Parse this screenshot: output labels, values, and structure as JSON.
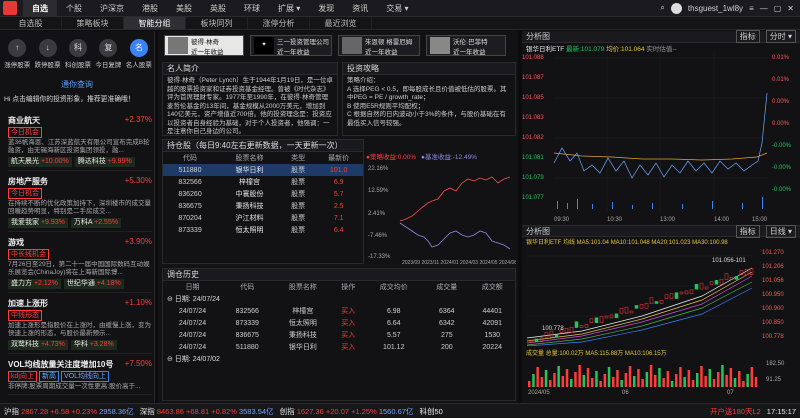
{
  "topbar": {
    "tabs": [
      "自选",
      "个股",
      "沪深京",
      "港股",
      "美股",
      "英股",
      "环球",
      "扩展",
      "发现",
      "资讯",
      "交易"
    ],
    "user": "thsguest_1wl8y"
  },
  "subnav": {
    "tabs": [
      "自选股",
      "策略板块",
      "智能分组",
      "板块同列",
      "涨停分析",
      "最近浏览"
    ]
  },
  "left": {
    "buttons": [
      "涨停股票",
      "跌停股票",
      "科创股票",
      "今日复牌",
      "名人股票"
    ],
    "link": "通你查询",
    "prompt": "Hi 点击编辑你的投资形象，推荐更准确哦！",
    "cards": [
      {
        "title": "商业航天",
        "pct": "+2.37%",
        "tag": "今日机会",
        "desc": "蓝36帆海恩、江苏深蓝航天有限公司宣布完成B轮融资，由无锡海新区投资集团领投，融...",
        "chips": [
          [
            "航天晨光",
            "+10.00%"
          ],
          [
            "腾达科技",
            "+9.99%"
          ]
        ]
      },
      {
        "title": "房地产服务",
        "pct": "+5.30%",
        "tag": "今日机会",
        "desc": "在持续不断的优化政策加持下，深圳楼市的成交量回暖趋势明显，特别是二手房成交...",
        "chips": [
          [
            "我爱我家",
            "+9.93%"
          ],
          [
            "万科A",
            "+2.55%"
          ]
        ]
      },
      {
        "title": "游戏",
        "pct": "+3.90%",
        "tag": "中长线机会",
        "desc": "7月26日至29日，第二十一届中国国际数码互动娱乐展览会(ChinaJoy)将在上海新国际博...",
        "chips": [
          [
            "盛力方",
            "+2.12%"
          ],
          [
            "世纪华通",
            "+4.18%"
          ]
        ]
      },
      {
        "title": "加速上涨形",
        "pct": "+1.10%",
        "tag": "中线形态",
        "desc": "加速上涨形是指股价在上涨时，由缓慢上涨，变为快速上涨的形态，与股价最新预示...",
        "chips": [
          [
            "双鹭科技",
            "+4.73%"
          ],
          [
            "华科",
            "+3.28%"
          ]
        ]
      },
      {
        "title": "VOL均线放量关注度增加10号",
        "pct": "+7.50%",
        "tag": "kdj向上",
        "tag2": "新高",
        "tag3": "VOL均线向上",
        "desc": "非停牌:股票周期成交量一次性更高:股价高于...",
        "chips": []
      }
    ]
  },
  "mid": {
    "investors": [
      {
        "name": "彼得·林奇",
        "sub": "近一年收益"
      },
      {
        "name": "三一投资管理公司",
        "sub": "近一年收益"
      },
      {
        "name": "朱恩顿 格雷厄姆",
        "sub": "近一年收益"
      },
      {
        "name": "沃伦·巴菲特",
        "sub": "近一年收益"
      }
    ],
    "bio_title": "名人简介",
    "bio": "彼得·林奇（Peter Lynch）生于1944年1月19日，是一位卓越的股票投资家和证券投资基金经理。曾被《时代杂志》评为首席理财专家。1977年至1990年，在彼得·林奇管理麦哲伦基金的13年间，基金规模从2000万美元，增加到140亿美元，资产增值近700倍。他的投资理念是：投资应以投资者自身经验为基础，对于个人投资者，他强调：一是注意你自己身边的公司。",
    "strategy_title": "投资攻略",
    "strategy": "策略介绍：\nA 选择PEG < 0.5，即每股成长且价值被低估的股票。其中PEG = PE / growth_rate；\nB 使用E5R规则平均配权；\nC 根据自然的日内波动小于3%的条件，与股价基础在有最低买入信号较强。",
    "holdings_title": "持仓股（每日9:40左右更新数据，一天更新一次）",
    "holdings_headers": [
      "代码",
      "股票名称",
      "类型",
      "最新价"
    ],
    "holdings": [
      [
        "511880",
        "银华日利",
        "股票",
        "101.0"
      ],
      [
        "832566",
        "梓橦宫",
        "股票",
        "6.9"
      ],
      [
        "836260",
        "中寰股份",
        "股票",
        "5.7"
      ],
      [
        "836675",
        "秉扬科技",
        "股票",
        "2.5"
      ],
      [
        "870204",
        "沪江材料",
        "股票",
        "7.1"
      ],
      [
        "873339",
        "恒太照明",
        "股票",
        "6.4"
      ]
    ],
    "chart_header": {
      "title": "策略收益",
      "v1_label": "策略收益:",
      "v1": "0.00%",
      "v2_label": "基准收益:",
      "v2": "-12.49%"
    },
    "trade_title": "调仓历史",
    "trade_headers": [
      "日期",
      "代码",
      "股票名称",
      "操作",
      "成交均价",
      "成交量",
      "成交额"
    ],
    "trade_groups": [
      {
        "date": "日期: 24/07/24",
        "rows": [
          [
            "24/07/24",
            "832566",
            "梓橦宫",
            "买入",
            "6.98",
            "6364",
            "44401"
          ],
          [
            "24/07/24",
            "873339",
            "恒太照明",
            "买入",
            "6.64",
            "6342",
            "42091"
          ],
          [
            "24/07/24",
            "836675",
            "秉扬科技",
            "买入",
            "5.57",
            "275",
            "1530"
          ],
          [
            "24/07/24",
            "511880",
            "银华日利",
            "买入",
            "101.12",
            "200",
            "20224"
          ]
        ]
      },
      {
        "date": "日期: 24/07/02",
        "rows": []
      }
    ]
  },
  "right": {
    "panel_title": "分析图",
    "fmt": "指标",
    "period": "分时",
    "intraday_label": "银华日利ETF",
    "intraday_last": "最新:101.079",
    "intraday_avg": "均价:101.064",
    "intraday_note": "实时估值--",
    "time_labels": [
      "09:30",
      "10:30",
      "13:00",
      "14:00",
      "15:00"
    ],
    "intraday_y": [
      "101.088",
      "101.087",
      "101.085",
      "101.083",
      "101.082",
      "101.081",
      "101.079",
      "101.077"
    ],
    "intraday_pct": [
      "0.01%",
      "0.01%",
      "0.00%",
      "0.00%",
      "-0.00%",
      "-0.00%",
      "-0.00%"
    ],
    "daily_tab": "日线",
    "daily_period": "日线",
    "daily_legend": "银华日利ETF  均线  MA5:101.04  MA10:101.048  MA20:101.023  MA30:100.98",
    "daily_y": [
      "101.270",
      "101.206",
      "101.056",
      "100.950",
      "100.900",
      "100.850",
      "100.778"
    ],
    "daily_hi": "101.056-101",
    "daily_lo": "100.778",
    "vol_legend": "成交量  总量:100.02万  MA5:115.88万  MA10:106.15万",
    "vol_y": [
      "182.50",
      "91.25"
    ],
    "vol_x": [
      "2024/05",
      "06",
      "07"
    ]
  },
  "status": {
    "items": [
      [
        "沪指",
        "2867.28",
        "+6.58",
        "+0.23%",
        "2958.36亿"
      ],
      [
        "深指",
        "8463.86",
        "+68.81",
        "+0.82%",
        "3583.54亿"
      ],
      [
        "创指",
        "1627.36",
        "+20.07",
        "+1.25%",
        "1560.67亿"
      ],
      [
        "科创50",
        "",
        "",
        "",
        ""
      ]
    ],
    "open": "开户送180天L2",
    "time": "17:15:17"
  }
}
